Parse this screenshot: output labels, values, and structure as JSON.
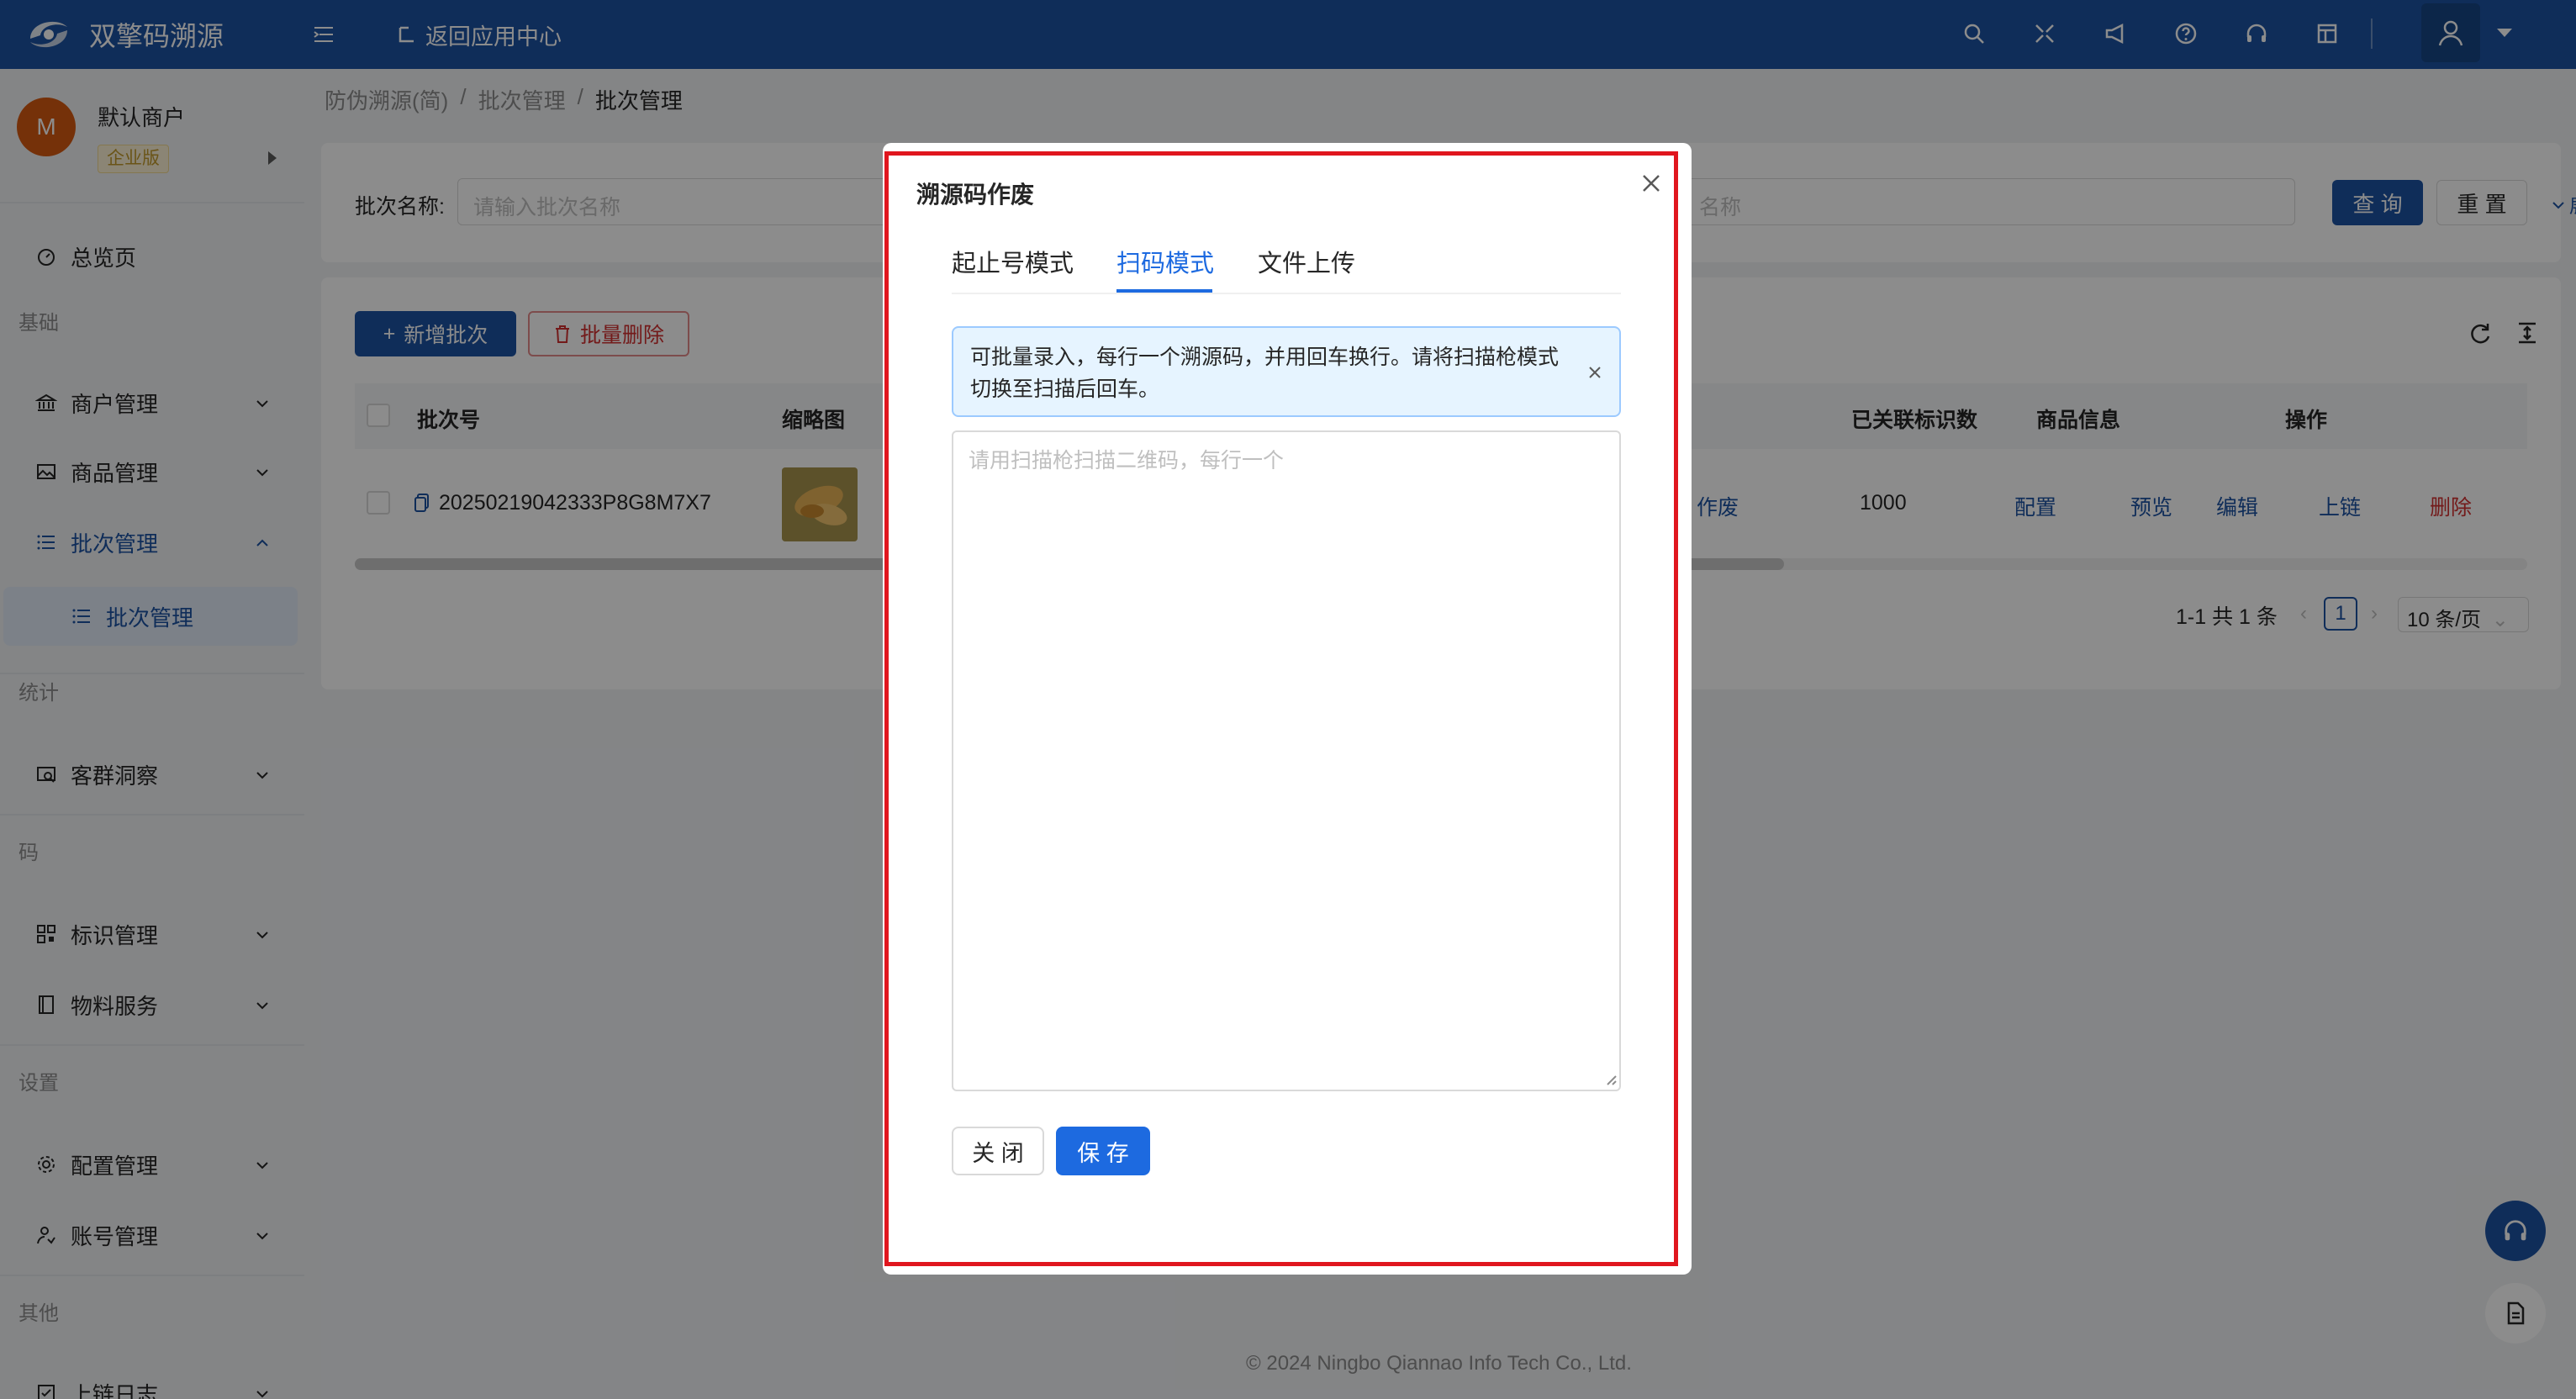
{
  "header": {
    "app_title": "双擎码溯源",
    "back_link": "返回应用中心",
    "icons": [
      "search-icon",
      "fullscreen-icon",
      "announce-icon",
      "help-icon",
      "headset-icon",
      "layout-icon",
      "user-icon"
    ],
    "brand_color": "#1d52a3"
  },
  "merchant": {
    "avatar_letter": "M",
    "name": "默认商户",
    "badge": "企业版"
  },
  "sidebar": {
    "dashboard": "总览页",
    "groups": {
      "basic": "基础",
      "stats": "统计",
      "code": "码",
      "settings": "设置",
      "other": "其他"
    },
    "items": {
      "merchant_mgmt": "商户管理",
      "product_mgmt": "商品管理",
      "batch_mgmt": "批次管理",
      "batch_mgmt_sub": "批次管理",
      "customer_insight": "客群洞察",
      "tag_mgmt": "标识管理",
      "material_service": "物料服务",
      "config_mgmt": "配置管理",
      "account_mgmt": "账号管理",
      "chain_log": "上链日志"
    }
  },
  "breadcrumb": [
    "防伪溯源(简)",
    "批次管理",
    "批次管理"
  ],
  "breadcrumb_sep": "/",
  "search": {
    "label": "批次名称:",
    "placeholder": "请输入批次名称",
    "placeholder2_partial": "名称",
    "query_button": "查 询",
    "reset_button": "重 置",
    "expand": "展开"
  },
  "table": {
    "add_button": "新增批次",
    "batch_delete_button": "批量删除",
    "columns": {
      "batch_no": "批次号",
      "thumbnail": "缩略图",
      "linked_count": "已关联标识数",
      "product_info": "商品信息",
      "actions": "操作"
    },
    "rows": [
      {
        "batch_no": "20250219042333P8G8M7X7",
        "void_link": "作废",
        "linked_count": "1000",
        "product_config": "配置",
        "preview": "预览",
        "edit": "编辑",
        "chain": "上链",
        "delete": "删除"
      }
    ],
    "pagination": {
      "total": "1-1 共 1 条",
      "current_page": "1",
      "page_size": "10 条/页"
    }
  },
  "footer": "© 2024 Ningbo Qiannao Info Tech Co., Ltd.",
  "modal": {
    "title": "溯源码作废",
    "tabs": [
      "起止号模式",
      "扫码模式",
      "文件上传"
    ],
    "active_tab": "扫码模式",
    "alert": "可批量录入，每行一个溯源码，并用回车换行。请将扫描枪模式切换至扫描后回车。",
    "textarea_placeholder": "请用扫描枪扫描二维码，每行一个",
    "close_button": "关 闭",
    "save_button": "保 存",
    "accent_color": "#1d6ae0",
    "highlight_color": "#e0161e"
  }
}
